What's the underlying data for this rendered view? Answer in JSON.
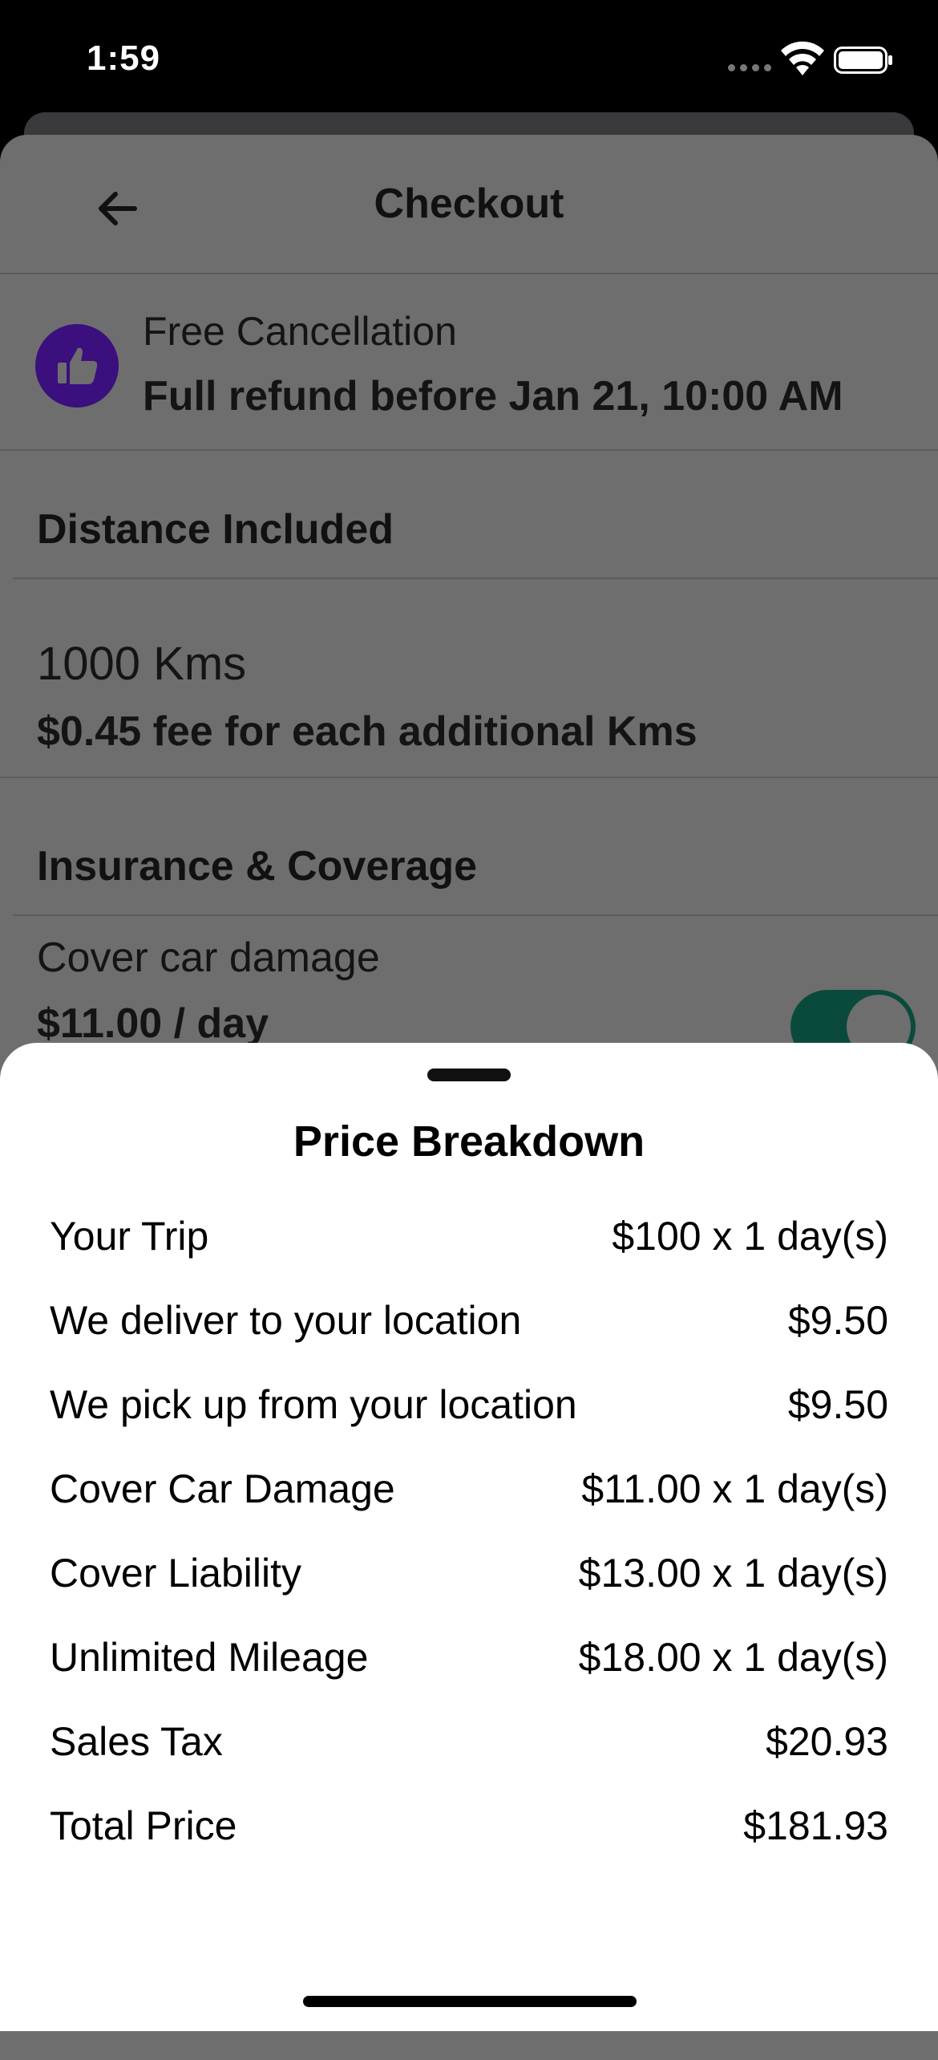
{
  "status_bar": {
    "time": "1:59"
  },
  "checkout": {
    "title": "Checkout",
    "cancellation": {
      "title": "Free Cancellation",
      "subtitle": "Full refund before Jan 21, 10:00 AM"
    },
    "distance": {
      "heading": "Distance Included",
      "amount": "1000 Kms",
      "fee": "$0.45 fee for each additional Kms"
    },
    "insurance": {
      "heading": "Insurance & Coverage",
      "item_label": "Cover car damage",
      "item_price": "$11.00 / day",
      "toggle_on": true
    }
  },
  "price_breakdown": {
    "title": "Price Breakdown",
    "rows": [
      {
        "label": "Your Trip",
        "value": "$100 x 1 day(s)"
      },
      {
        "label": "We deliver to your location",
        "value": "$9.50"
      },
      {
        "label": "We pick up from your location",
        "value": "$9.50"
      },
      {
        "label": "Cover Car Damage",
        "value": "$11.00 x 1 day(s)"
      },
      {
        "label": "Cover Liability",
        "value": "$13.00 x 1 day(s)"
      },
      {
        "label": "Unlimited Mileage",
        "value": "$18.00 x 1 day(s)"
      },
      {
        "label": "Sales Tax",
        "value": "$20.93"
      },
      {
        "label": "Total Price",
        "value": "$181.93"
      }
    ]
  },
  "colors": {
    "accent_purple": "#3b0f7e",
    "toggle_green": "#0a4a3c",
    "dim_overlay": "#6e6e6e"
  }
}
